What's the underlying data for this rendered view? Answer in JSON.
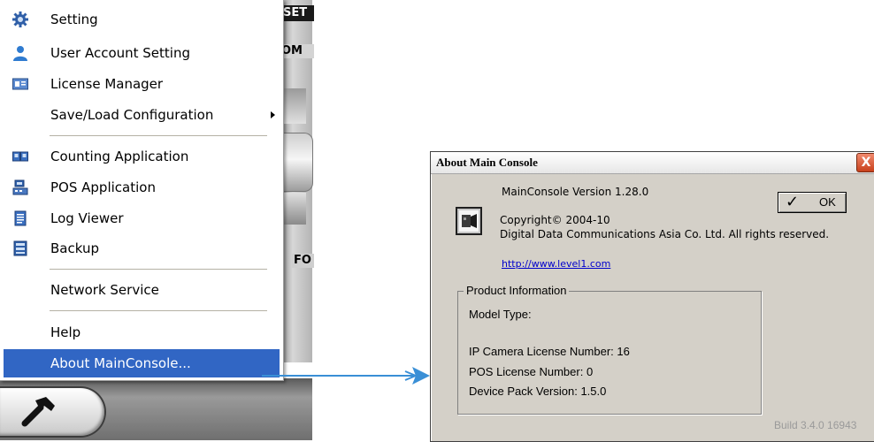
{
  "background_app": {
    "labels": [
      "SET",
      "OM",
      "FO"
    ],
    "tool_button_icon": "hammer-icon"
  },
  "menu": {
    "items": [
      {
        "label": "Setting",
        "icon": "gear-icon"
      },
      {
        "label": "User Account Setting",
        "icon": "user-icon"
      },
      {
        "label": "License Manager",
        "icon": "license-card-icon"
      },
      {
        "label": "Save/Load Configuration",
        "icon": "",
        "has_submenu": true
      },
      {
        "label": "Counting Application",
        "icon": "counting-icon"
      },
      {
        "label": "POS Application",
        "icon": "pos-terminal-icon"
      },
      {
        "label": "Log Viewer",
        "icon": "log-document-icon"
      },
      {
        "label": "Backup",
        "icon": "backup-icon"
      },
      {
        "label": "Network Service",
        "icon": ""
      },
      {
        "label": "Help",
        "icon": ""
      },
      {
        "label": "About MainConsole...",
        "icon": "",
        "selected": true
      }
    ],
    "selected_color": "#3166c4"
  },
  "connector": {
    "color": "#3a8fd6"
  },
  "about_dialog": {
    "title": "About Main Console",
    "close_label": "X",
    "version_line": "MainConsole Version   1.28.0",
    "copyright_line": "Copyright© 2004-10",
    "company_line": "Digital Data Communications Asia Co. Ltd. All rights reserved.",
    "link": "http://www.level1.com",
    "ok_label": "OK",
    "product_info": {
      "title": "Product Information",
      "model_type": "Model Type:",
      "ip_camera_license": "IP Camera License Number: 16",
      "pos_license": "POS License Number: 0",
      "device_pack": "Device Pack Version:  1.5.0"
    },
    "build": "Build 3.4.0 16943"
  }
}
